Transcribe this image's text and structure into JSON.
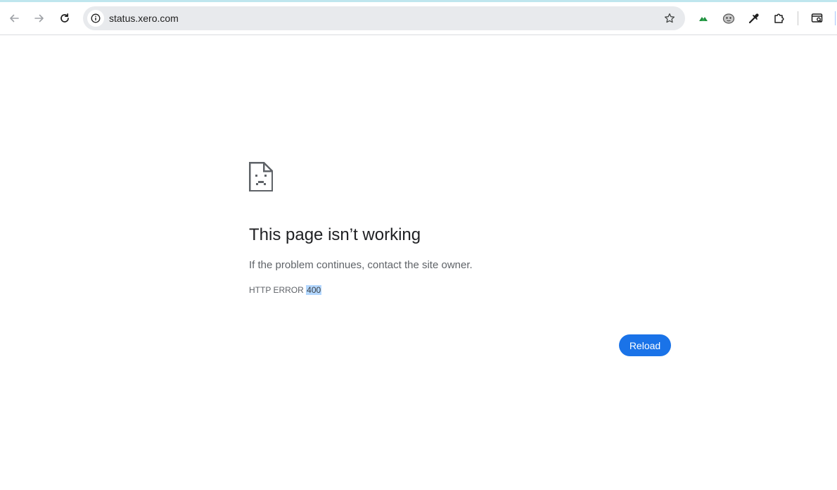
{
  "browser": {
    "address_bar": {
      "url": "status.xero.com",
      "site_info_icon": "info-icon",
      "bookmark_icon": "star-outline-icon"
    },
    "nav": {
      "back_icon": "arrow-left-icon",
      "forward_icon": "arrow-right-icon",
      "reload_icon": "reload-icon"
    },
    "extensions": [
      {
        "icon": "green-leaf-extension-icon"
      },
      {
        "icon": "face-extension-icon"
      },
      {
        "icon": "eyedropper-icon"
      },
      {
        "icon": "puzzle-piece-icon"
      },
      {
        "icon": "tab-search-icon"
      }
    ]
  },
  "error_page": {
    "icon": "sad-page-icon",
    "heading": "This page isn’t working",
    "suggestion": "If the problem continues, contact the site owner.",
    "error_prefix": "HTTP ERROR",
    "error_code": "400",
    "reload_label": "Reload"
  },
  "colors": {
    "accent": "#1a73e8",
    "selection": "#b3d7ff",
    "omnibox_bg": "#e8eaed"
  }
}
